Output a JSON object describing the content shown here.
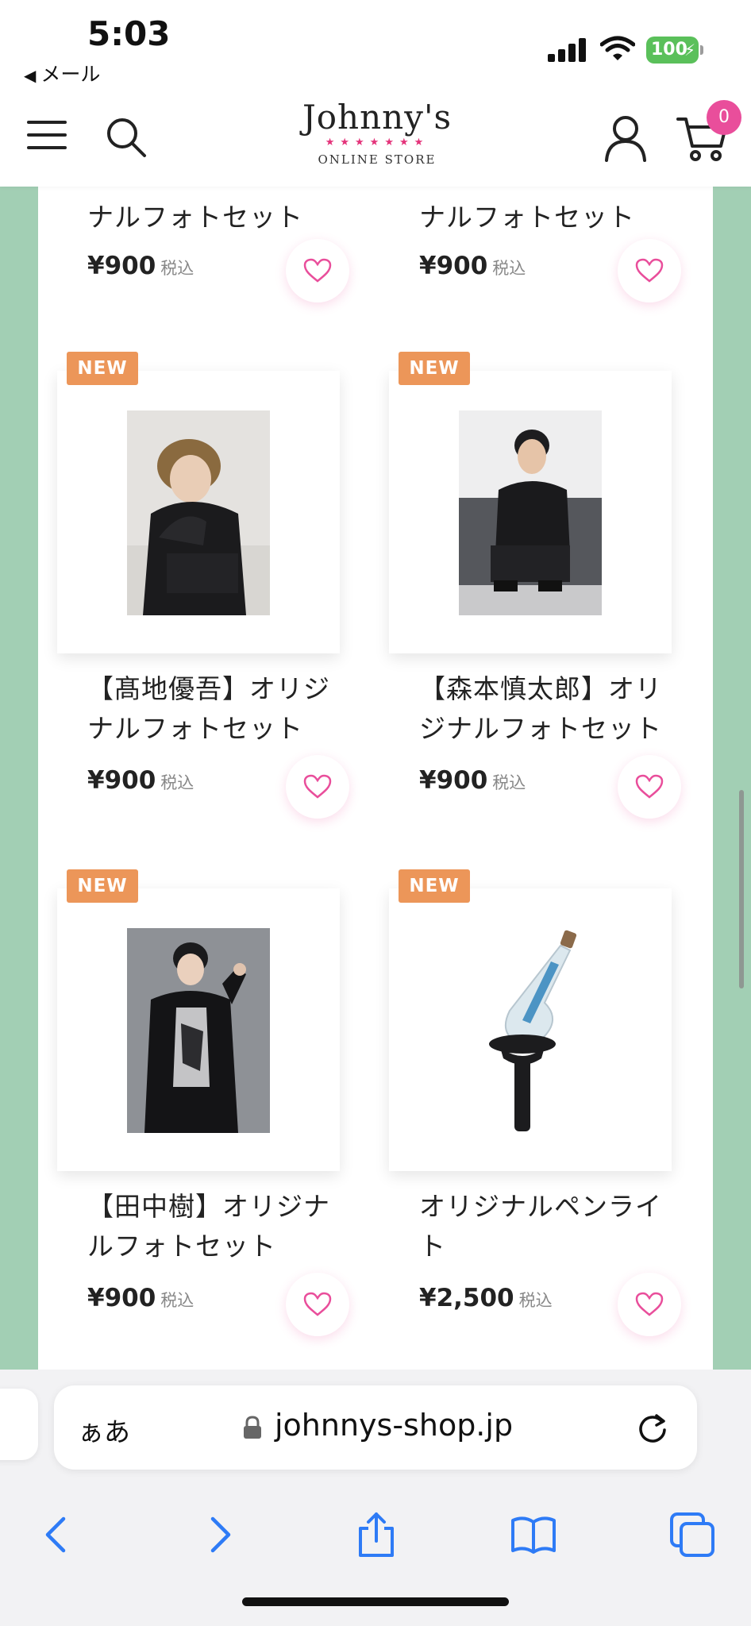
{
  "status_bar": {
    "time": "5:03",
    "back_label": "メール",
    "battery": "100"
  },
  "header": {
    "logo_main": "Johnny's",
    "logo_stars": "★★★★★★★",
    "logo_sub": "ONLINE STORE",
    "cart_count": "0",
    "icons": [
      "menu-icon",
      "search-icon",
      "account-icon",
      "cart-icon"
    ]
  },
  "products": [
    {
      "title_line2": "ナルフォトセット",
      "price": "¥900",
      "tax": "税込",
      "new": false
    },
    {
      "title_line2": "ナルフォトセット",
      "price": "¥900",
      "tax": "税込",
      "new": false
    },
    {
      "badge": "NEW",
      "title_line1": "【髙地優吾】オリジ",
      "title_line2": "ナルフォトセット",
      "price": "¥900",
      "tax": "税込",
      "new": true
    },
    {
      "badge": "NEW",
      "title_line1": "【森本慎太郎】オリ",
      "title_line2": "ジナルフォトセット",
      "price": "¥900",
      "tax": "税込",
      "new": true
    },
    {
      "badge": "NEW",
      "title_line1": "【田中樹】オリジナ",
      "title_line2": "ルフォトセット",
      "price": "¥900",
      "tax": "税込",
      "new": true
    },
    {
      "badge": "NEW",
      "title_line1": "オリジナルペンライ",
      "title_line2": "ト",
      "price": "¥2,500",
      "tax": "税込",
      "new": true
    }
  ],
  "browser": {
    "aa_label": "ぁあ",
    "url": "johnnys-shop.jp"
  },
  "colors": {
    "accent_pink": "#e94e9b",
    "new_badge": "#ec9659",
    "side_green": "#a2cfb4",
    "ios_blue": "#2e7bf6"
  }
}
